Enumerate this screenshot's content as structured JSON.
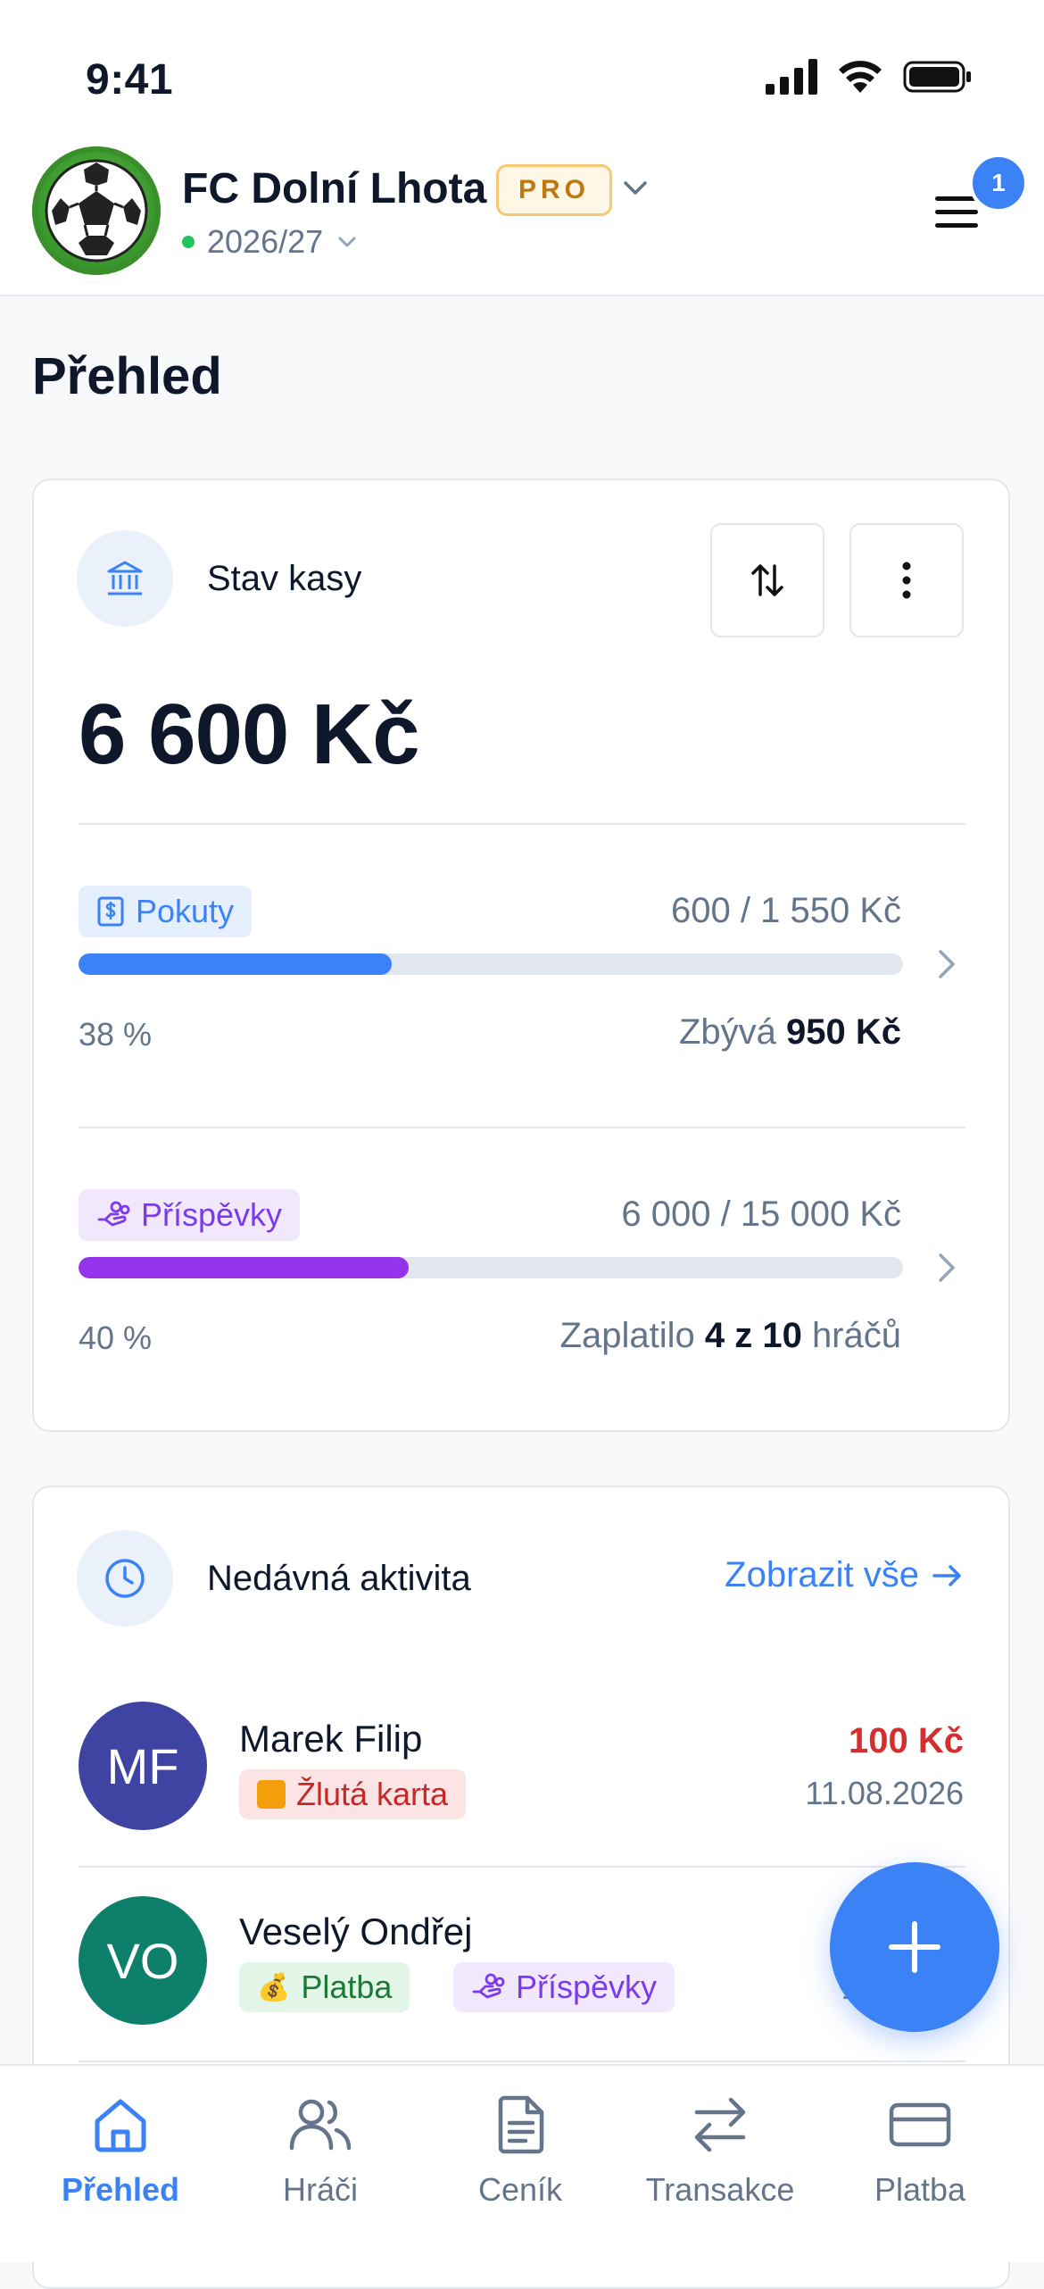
{
  "status_bar": {
    "time": "9:41"
  },
  "header": {
    "team_name": "FC Dolní Lhota",
    "badge": "PRO",
    "season": "2026/27",
    "notification_count": "1"
  },
  "page_title": "Přehled",
  "cash_card": {
    "title": "Stav kasy",
    "balance": "6 600 Kč",
    "fines": {
      "label": "Pokuty",
      "amount": "600 / 1 550 Kč",
      "progress": 0.38,
      "percent_text": "38 %",
      "remaining_label": "Zbývá",
      "remaining_value": "950 Kč",
      "color": "#3b82f6"
    },
    "contributions": {
      "label": "Příspěvky",
      "amount": "6 000 / 15 000 Kč",
      "progress": 0.4,
      "percent_text": "40 %",
      "paid_prefix": "Zaplatilo",
      "paid_value": "4 z 10",
      "paid_suffix": "hráčů",
      "color": "#9333ea"
    }
  },
  "activity_card": {
    "title": "Nedávná aktivita",
    "see_all": "Zobrazit vše",
    "items": [
      {
        "initials": "MF",
        "name": "Marek Filip",
        "tag": "Žlutá karta",
        "amount": "100 Kč",
        "date": "11.08.2026",
        "avatar_color": "#3f44a3",
        "amount_color": "#d32f2f"
      },
      {
        "initials": "VO",
        "name": "Veselý Ondřej",
        "tag": "Platba",
        "tag2": "Příspěvky",
        "amount": "+1",
        "date": "11.",
        "avatar_color": "#0d7f6a",
        "amount_color": "#2e9e47"
      }
    ]
  },
  "tabs": [
    {
      "label": "Přehled",
      "icon": "home-icon"
    },
    {
      "label": "Hráči",
      "icon": "users-icon"
    },
    {
      "label": "Ceník",
      "icon": "document-icon"
    },
    {
      "label": "Transakce",
      "icon": "transfer-icon"
    },
    {
      "label": "Platba",
      "icon": "card-icon"
    }
  ]
}
